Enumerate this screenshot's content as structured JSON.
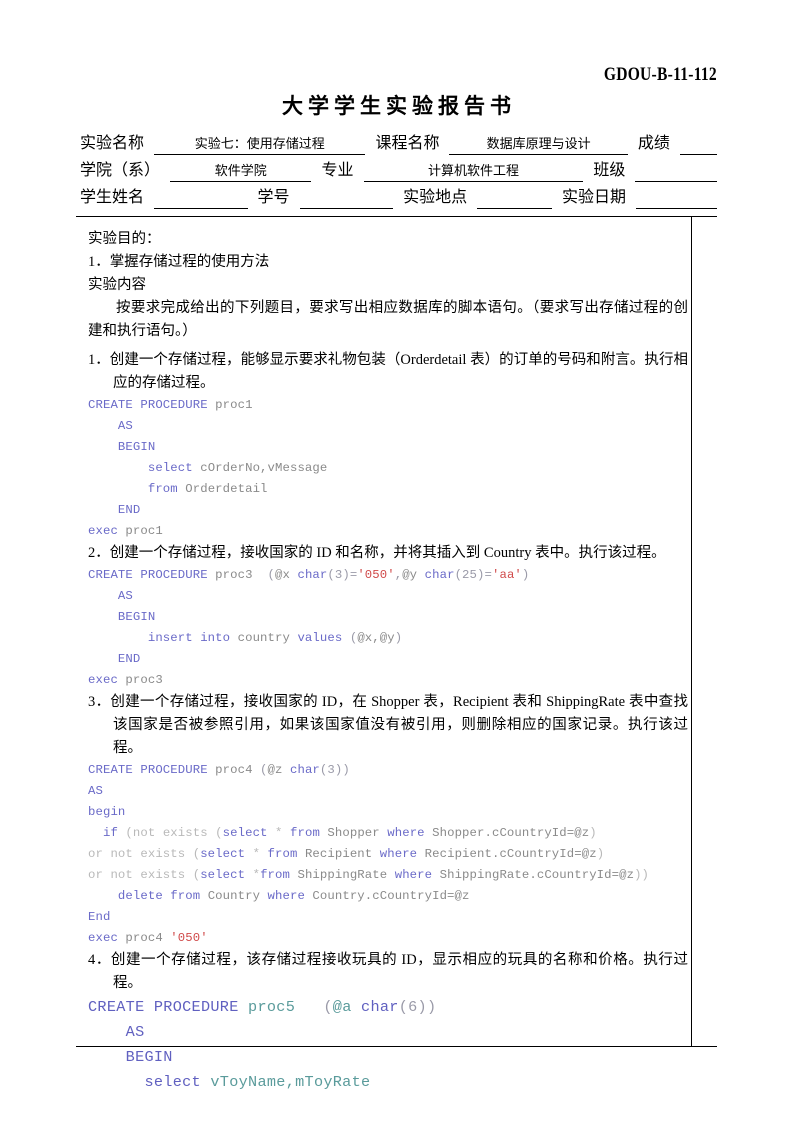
{
  "form_code": "GDOU-B-11-112",
  "title": "大学学生实验报告书",
  "header": {
    "rows": [
      {
        "cells": [
          {
            "type": "label",
            "text": "实验名称"
          },
          {
            "type": "fill",
            "text": "实验七：使用存储过程",
            "grow": 2.3
          },
          {
            "type": "label",
            "text": "课程名称"
          },
          {
            "type": "fill",
            "text": "数据库原理与设计",
            "grow": 2.1
          },
          {
            "type": "label",
            "text": "成绩"
          },
          {
            "type": "fill",
            "text": "",
            "grow": 1.05
          }
        ]
      },
      {
        "cells": [
          {
            "type": "label",
            "text": "学院（系）"
          },
          {
            "type": "fill",
            "text": "软件学院",
            "grow": 1.7
          },
          {
            "type": "label",
            "text": "专业"
          },
          {
            "type": "fill",
            "text": "计算机软件工程",
            "grow": 2.45
          },
          {
            "type": "label",
            "text": "班级"
          },
          {
            "type": "fill",
            "text": "",
            "grow": 1.55
          }
        ]
      },
      {
        "cells": [
          {
            "type": "label",
            "text": "学生姓名"
          },
          {
            "type": "fill",
            "text": "",
            "grow": 1.5
          },
          {
            "type": "label",
            "text": "学号"
          },
          {
            "type": "fill",
            "text": "",
            "grow": 1.5
          },
          {
            "type": "label",
            "text": "实验地点"
          },
          {
            "type": "fill",
            "text": "",
            "grow": 1.2
          },
          {
            "type": "label",
            "text": "实验日期"
          },
          {
            "type": "fill",
            "text": "",
            "grow": 1.3
          }
        ]
      }
    ]
  },
  "body": {
    "purpose_heading": "实验目的：",
    "purpose_item_1": "1．掌握存储过程的使用方法",
    "content_heading": "实验内容",
    "content_para": "按要求完成给出的下列题目，要求写出相应数据库的脚本语句。（要求写出存储过程的创建和执行语句。）",
    "q1": "1．创建一个存储过程，能够显示要求礼物包装（Orderdetail 表）的订单的号码和附言。执行相应的存储过程。",
    "q2": "2．创建一个存储过程，接收国家的 ID 和名称，并将其插入到 Country 表中。执行该过程。",
    "q3": "3．创建一个存储过程，接收国家的 ID，在 Shopper 表，Recipient 表和 ShippingRate 表中查找该国家是否被参照引用，如果该国家值没有被引用，则删除相应的国家记录。执行该过程。",
    "q4": "4．创建一个存储过程，该存储过程接收玩具的 ID，显示相应的玩具的名称和价格。执行过程。"
  },
  "code_blocks": {
    "block1": [
      "CREATE PROCEDURE proc1",
      "    AS",
      "    BEGIN",
      "        select cOrderNo,vMessage",
      "        from Orderdetail",
      "    END",
      "exec proc1"
    ],
    "block2": [
      "CREATE PROCEDURE proc3  (@x char(3)='050',@y char(25)='aa')",
      "    AS",
      "    BEGIN",
      "        insert into country values (@x,@y)",
      "    END",
      "exec proc3"
    ],
    "block3": [
      "CREATE PROCEDURE proc4 (@z char(3))",
      "AS",
      "begin",
      "  if (not exists (select * from Shopper where Shopper.cCountryId=@z)",
      "or not exists (select * from Recipient where Recipient.cCountryId=@z)",
      "or not exists (select *from ShippingRate where ShippingRate.cCountryId=@z))",
      "    delete from Country where Country.cCountryId=@z",
      "End",
      "exec proc4 '050'"
    ],
    "block4": [
      "CREATE PROCEDURE proc5   (@a char(6))",
      "    AS",
      "    BEGIN",
      "      select vToyName,mToyRate"
    ]
  },
  "colors": {
    "keyword": "#6a6ac8",
    "identifier": "#8a8a8a",
    "string": "#d04a4a",
    "dim": "#b9b9b9",
    "teal": "#5a9b9b",
    "text": "#000000"
  }
}
